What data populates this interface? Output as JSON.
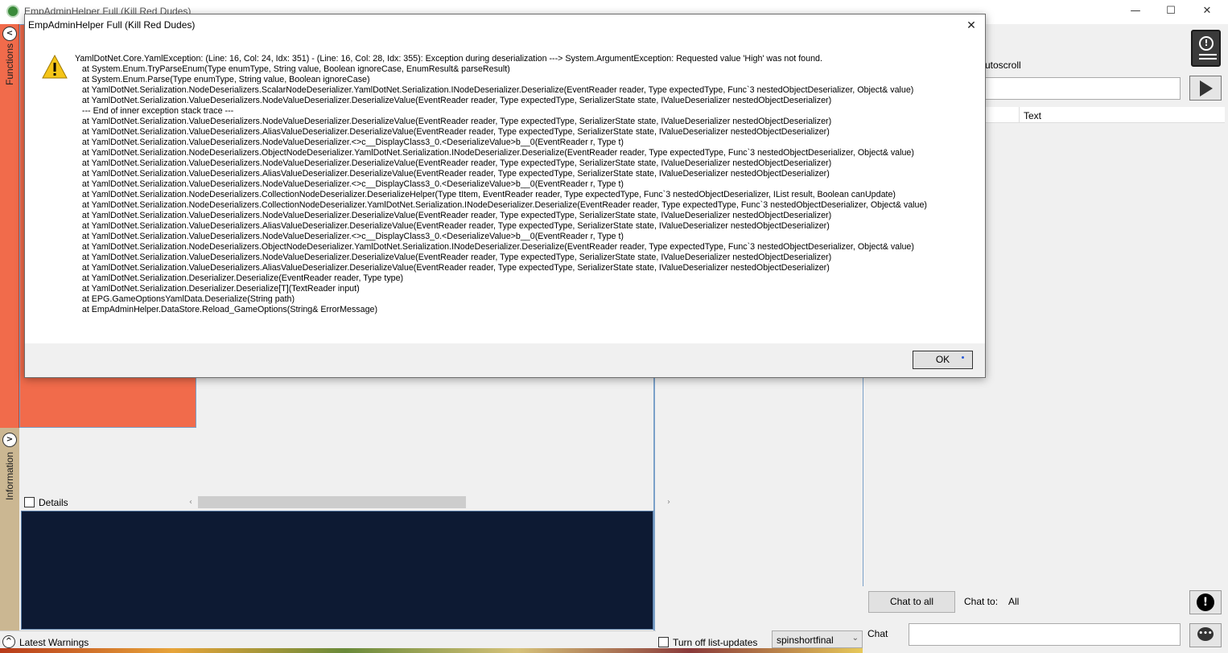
{
  "main_window": {
    "title": "EmpAdminHelper Full (Kill Red Dudes)",
    "controls": {
      "minimize": "—",
      "maximize": "☐",
      "close": "✕"
    }
  },
  "left_tabs": {
    "functions_label": "Functions",
    "information_label": "Information",
    "functions_color": "#f16b4b",
    "information_color": "#cbb792"
  },
  "details": {
    "label": "Details",
    "checked": false
  },
  "bottom_bar": {
    "latest_warnings": "Latest Warnings",
    "turn_off_label": "Turn off list-updates",
    "user_select_value": "spinshortfinal"
  },
  "right_panel": {
    "autoscroll_label": "utoscroll",
    "log_columns": [
      "",
      "Text"
    ],
    "chat_to_all_button": "Chat to all",
    "chat_to_label": "Chat to:",
    "chat_to_value": "All",
    "chat_label": "Chat",
    "icons": [
      "alert-bell-icon",
      "play-icon",
      "exclamation-icon",
      "chat-bubble-icon"
    ]
  },
  "dialog": {
    "title": "EmpAdminHelper Full (Kill Red Dudes)",
    "close_glyph": "✕",
    "icon": "warning-icon",
    "ok_label": "OK",
    "message": "YamlDotNet.Core.YamlException: (Line: 16, Col: 24, Idx: 351) - (Line: 16, Col: 28, Idx: 355): Exception during deserialization ---> System.ArgumentException: Requested value 'High' was not found.\n   at System.Enum.TryParseEnum(Type enumType, String value, Boolean ignoreCase, EnumResult& parseResult)\n   at System.Enum.Parse(Type enumType, String value, Boolean ignoreCase)\n   at YamlDotNet.Serialization.NodeDeserializers.ScalarNodeDeserializer.YamlDotNet.Serialization.INodeDeserializer.Deserialize(EventReader reader, Type expectedType, Func`3 nestedObjectDeserializer, Object& value)\n   at YamlDotNet.Serialization.ValueDeserializers.NodeValueDeserializer.DeserializeValue(EventReader reader, Type expectedType, SerializerState state, IValueDeserializer nestedObjectDeserializer)\n   --- End of inner exception stack trace ---\n   at YamlDotNet.Serialization.ValueDeserializers.NodeValueDeserializer.DeserializeValue(EventReader reader, Type expectedType, SerializerState state, IValueDeserializer nestedObjectDeserializer)\n   at YamlDotNet.Serialization.ValueDeserializers.AliasValueDeserializer.DeserializeValue(EventReader reader, Type expectedType, SerializerState state, IValueDeserializer nestedObjectDeserializer)\n   at YamlDotNet.Serialization.ValueDeserializers.NodeValueDeserializer.<>c__DisplayClass3_0.<DeserializeValue>b__0(EventReader r, Type t)\n   at YamlDotNet.Serialization.NodeDeserializers.ObjectNodeDeserializer.YamlDotNet.Serialization.INodeDeserializer.Deserialize(EventReader reader, Type expectedType, Func`3 nestedObjectDeserializer, Object& value)\n   at YamlDotNet.Serialization.ValueDeserializers.NodeValueDeserializer.DeserializeValue(EventReader reader, Type expectedType, SerializerState state, IValueDeserializer nestedObjectDeserializer)\n   at YamlDotNet.Serialization.ValueDeserializers.AliasValueDeserializer.DeserializeValue(EventReader reader, Type expectedType, SerializerState state, IValueDeserializer nestedObjectDeserializer)\n   at YamlDotNet.Serialization.ValueDeserializers.NodeValueDeserializer.<>c__DisplayClass3_0.<DeserializeValue>b__0(EventReader r, Type t)\n   at YamlDotNet.Serialization.NodeDeserializers.CollectionNodeDeserializer.DeserializeHelper(Type tItem, EventReader reader, Type expectedType, Func`3 nestedObjectDeserializer, IList result, Boolean canUpdate)\n   at YamlDotNet.Serialization.NodeDeserializers.CollectionNodeDeserializer.YamlDotNet.Serialization.INodeDeserializer.Deserialize(EventReader reader, Type expectedType, Func`3 nestedObjectDeserializer, Object& value)\n   at YamlDotNet.Serialization.ValueDeserializers.NodeValueDeserializer.DeserializeValue(EventReader reader, Type expectedType, SerializerState state, IValueDeserializer nestedObjectDeserializer)\n   at YamlDotNet.Serialization.ValueDeserializers.AliasValueDeserializer.DeserializeValue(EventReader reader, Type expectedType, SerializerState state, IValueDeserializer nestedObjectDeserializer)\n   at YamlDotNet.Serialization.ValueDeserializers.NodeValueDeserializer.<>c__DisplayClass3_0.<DeserializeValue>b__0(EventReader r, Type t)\n   at YamlDotNet.Serialization.NodeDeserializers.ObjectNodeDeserializer.YamlDotNet.Serialization.INodeDeserializer.Deserialize(EventReader reader, Type expectedType, Func`3 nestedObjectDeserializer, Object& value)\n   at YamlDotNet.Serialization.ValueDeserializers.NodeValueDeserializer.DeserializeValue(EventReader reader, Type expectedType, SerializerState state, IValueDeserializer nestedObjectDeserializer)\n   at YamlDotNet.Serialization.ValueDeserializers.AliasValueDeserializer.DeserializeValue(EventReader reader, Type expectedType, SerializerState state, IValueDeserializer nestedObjectDeserializer)\n   at YamlDotNet.Serialization.Deserializer.Deserialize(EventReader reader, Type type)\n   at YamlDotNet.Serialization.Deserializer.Deserialize[T](TextReader input)\n   at EPG.GameOptionsYamlData.Deserialize(String path)\n   at EmpAdminHelper.DataStore.Reload_GameOptions(String& ErrorMessage)"
  }
}
